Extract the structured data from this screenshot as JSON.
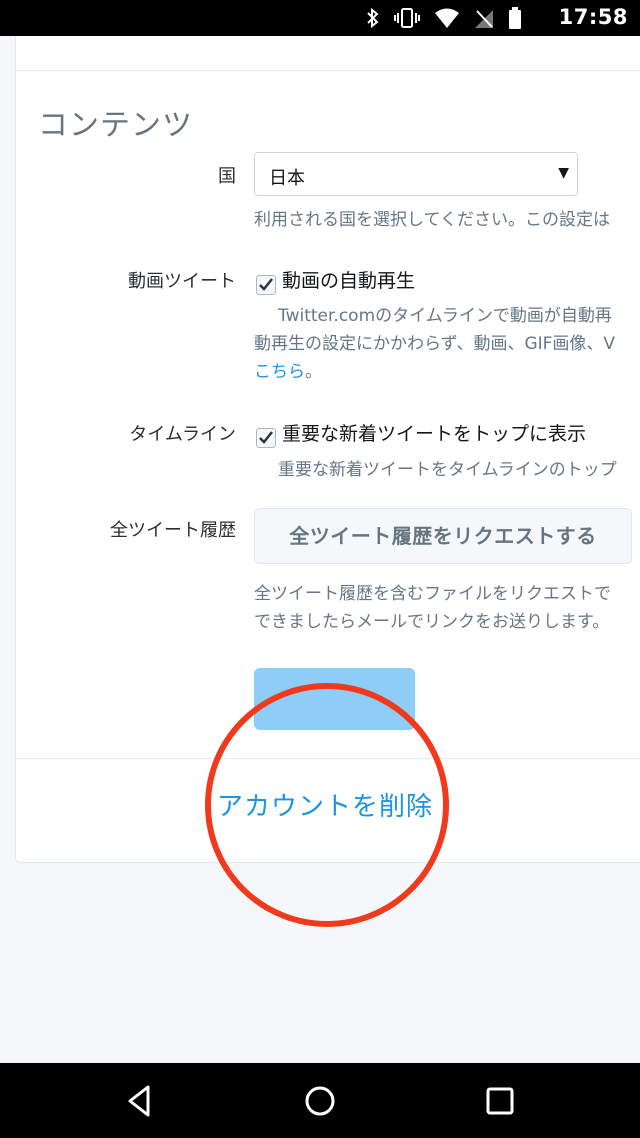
{
  "status_bar": {
    "time": "17:58",
    "icons": [
      "bluetooth-icon",
      "vibrate-icon",
      "wifi-icon",
      "no-signal-icon",
      "battery-icon"
    ]
  },
  "content": {
    "section_title": "コンテンツ",
    "country": {
      "label": "国",
      "selected": "日本",
      "help": "利用される国を選択してください。この設定は"
    },
    "video": {
      "label": "動画ツイート",
      "checkbox_label": "動画の自動再生",
      "checked": true,
      "help_line1": "Twitter.comのタイムラインで動画が自動再",
      "help_line2": "動再生の設定にかかわらず、動画、GIF画像、V",
      "help_link": "こちら",
      "help_link_suffix": "。"
    },
    "timeline": {
      "label": "タイムライン",
      "checkbox_label": "重要な新着ツイートをトップに表示",
      "checked": true,
      "help": "重要な新着ツイートをタイムラインのトップ"
    },
    "archive": {
      "label": "全ツイート履歴",
      "button_label": "全ツイート履歴をリクエストする",
      "help_line1": "全ツイート履歴を含むファイルをリクエストで",
      "help_line2": "できましたらメールでリンクをお送りします。"
    },
    "delete_account_label": "アカウントを削除"
  },
  "colors": {
    "link": "#1b95e0",
    "highlight_circle": "#f03a1d",
    "save_button": "#8ecdf5"
  },
  "nav_bar": {
    "buttons": [
      "back-icon",
      "home-icon",
      "recents-icon"
    ]
  }
}
